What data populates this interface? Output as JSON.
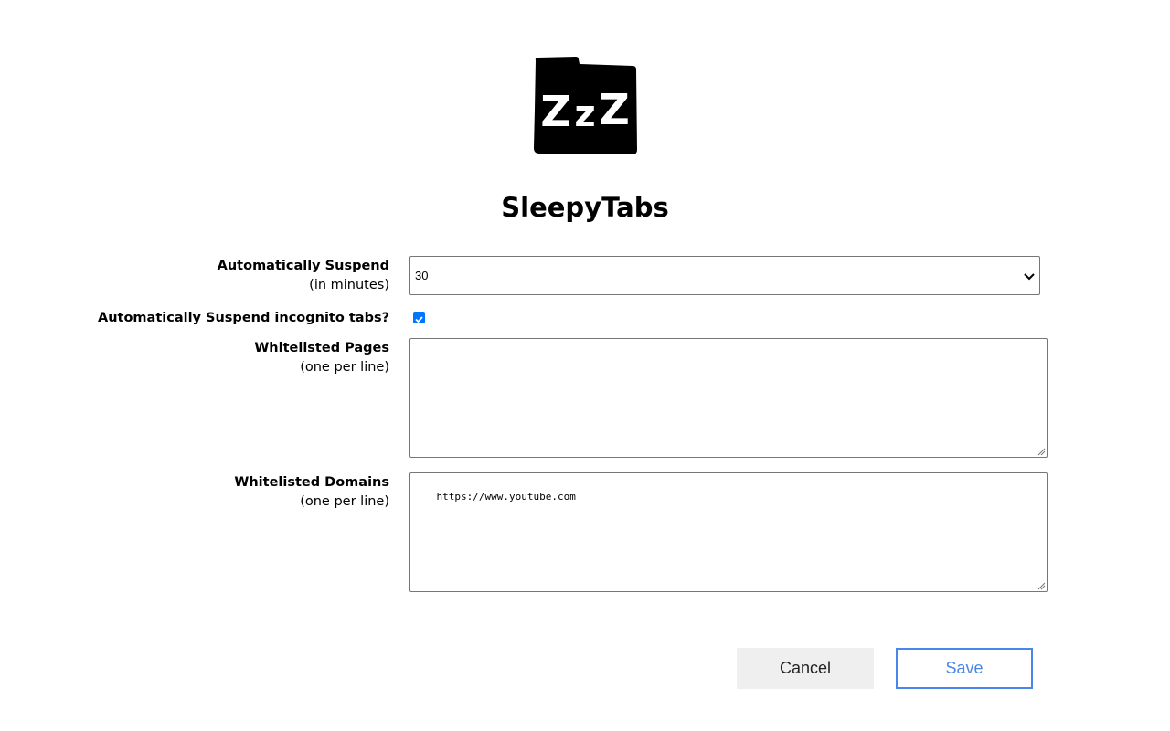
{
  "app": {
    "title": "SleepyTabs",
    "logo_icon": "zzz-folder-icon"
  },
  "settings": {
    "auto_suspend": {
      "label": "Automatically Suspend",
      "sublabel": "(in minutes)",
      "value": "30"
    },
    "incognito": {
      "label": "Automatically Suspend incognito tabs?",
      "checked": true
    },
    "whitelisted_pages": {
      "label": "Whitelisted Pages",
      "sublabel": "(one per line)",
      "value": ""
    },
    "whitelisted_domains": {
      "label": "Whitelisted Domains",
      "sublabel": "(one per line)",
      "value": "https://www.youtube.com"
    }
  },
  "actions": {
    "cancel_label": "Cancel",
    "save_label": "Save"
  },
  "colors": {
    "accent": "#4a86e8",
    "checkbox": "#0075ff",
    "cancel_bg": "#efefef"
  }
}
